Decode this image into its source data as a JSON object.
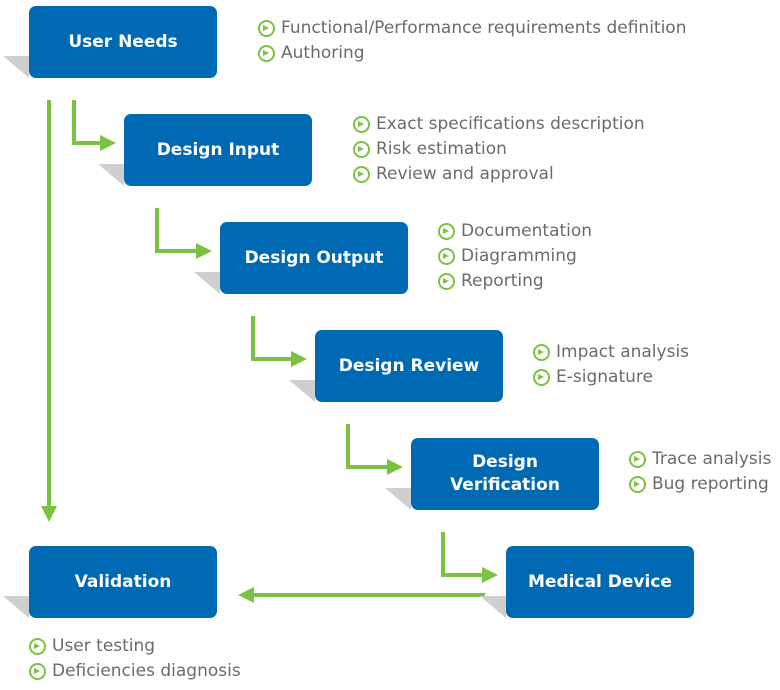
{
  "colors": {
    "box": "#0069b4",
    "arrow": "#7cc242",
    "text": "#6b6b6b",
    "shadow": "#cfcfcf"
  },
  "icon": "circle-arrow-right-icon",
  "steps": [
    {
      "label": "User Needs",
      "items": [
        "Functional/Performance requirements definition",
        "Authoring"
      ]
    },
    {
      "label": "Design Input",
      "items": [
        "Exact specifications description",
        "Risk estimation",
        "Review and approval"
      ]
    },
    {
      "label": "Design Output",
      "items": [
        "Documentation",
        "Diagramming",
        "Reporting"
      ]
    },
    {
      "label": "Design Review",
      "items": [
        "Impact analysis",
        "E-signature"
      ]
    },
    {
      "label": "Design Verification",
      "items": [
        "Trace analysis",
        "Bug reporting"
      ]
    },
    {
      "label": "Medical Device",
      "items": []
    },
    {
      "label": "Validation",
      "items": [
        "User testing",
        "Deficiencies diagnosis"
      ]
    }
  ]
}
